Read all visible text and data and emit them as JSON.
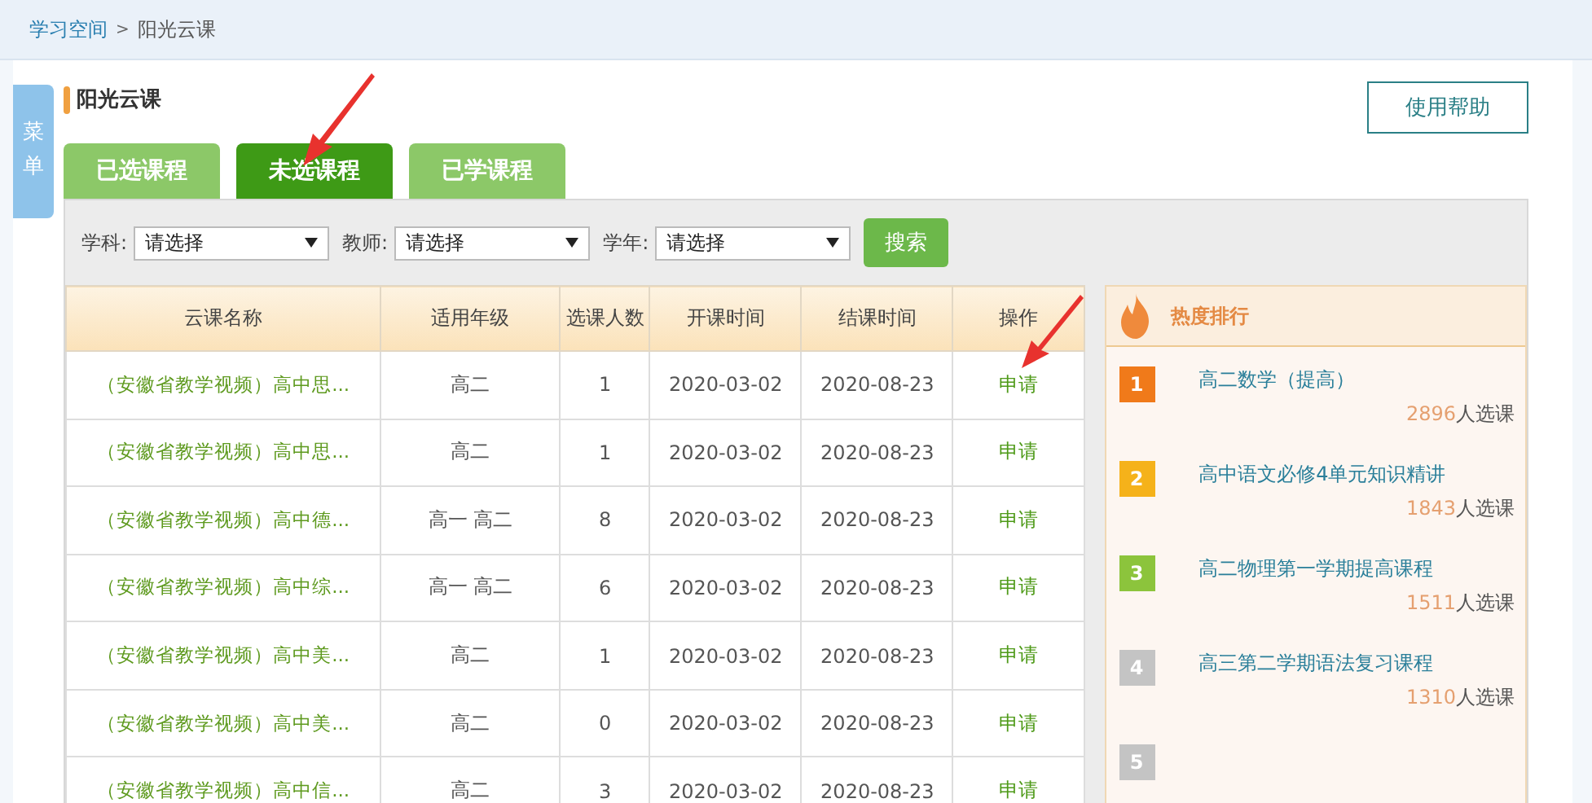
{
  "breadcrumb": {
    "link": "学习空间",
    "separator": ">",
    "current": "阳光云课"
  },
  "side_menu_tab": "菜单",
  "page_title": "阳光云课",
  "help_button": "使用帮助",
  "tabs": [
    {
      "label": "已选课程",
      "selected": false
    },
    {
      "label": "未选课程",
      "selected": true
    },
    {
      "label": "已学课程",
      "selected": false
    }
  ],
  "filters": [
    {
      "label": "学科:",
      "value": "请选择"
    },
    {
      "label": "教师:",
      "value": "请选择"
    },
    {
      "label": "学年:",
      "value": "请选择"
    }
  ],
  "search_button": "搜索",
  "table": {
    "columns": [
      "云课名称",
      "适用年级",
      "选课人数",
      "开课时间",
      "结课时间",
      "操作"
    ],
    "rows": [
      [
        "（安徽省教学视频）高中思...",
        "高二",
        "1",
        "2020-03-02",
        "2020-08-23",
        "申请"
      ],
      [
        "（安徽省教学视频）高中思...",
        "高二",
        "1",
        "2020-03-02",
        "2020-08-23",
        "申请"
      ],
      [
        "（安徽省教学视频）高中德...",
        "高一 高二",
        "8",
        "2020-03-02",
        "2020-08-23",
        "申请"
      ],
      [
        "（安徽省教学视频）高中综...",
        "高一 高二",
        "6",
        "2020-03-02",
        "2020-08-23",
        "申请"
      ],
      [
        "（安徽省教学视频）高中美...",
        "高二",
        "1",
        "2020-03-02",
        "2020-08-23",
        "申请"
      ],
      [
        "（安徽省教学视频）高中美...",
        "高二",
        "0",
        "2020-03-02",
        "2020-08-23",
        "申请"
      ],
      [
        "（安徽省教学视频）高中信...",
        "高二",
        "3",
        "2020-03-02",
        "2020-08-23",
        "申请"
      ]
    ]
  },
  "ranking": {
    "title": "热度排行",
    "items": [
      {
        "rank": "1",
        "color": "#f07a1a",
        "title": "高二数学（提高）",
        "count": "2896",
        "suffix": "人选课"
      },
      {
        "rank": "2",
        "color": "#f5b21a",
        "title": "高中语文必修4单元知识精讲",
        "count": "1843",
        "suffix": "人选课"
      },
      {
        "rank": "3",
        "color": "#8cc43c",
        "title": "高二物理第一学期提高课程",
        "count": "1511",
        "suffix": "人选课"
      },
      {
        "rank": "4",
        "color": "#c4c4c4",
        "title": "高三第二学期语法复习课程",
        "count": "1310",
        "suffix": "人选课"
      },
      {
        "rank": "5",
        "color": "#c4c4c4"
      }
    ]
  }
}
